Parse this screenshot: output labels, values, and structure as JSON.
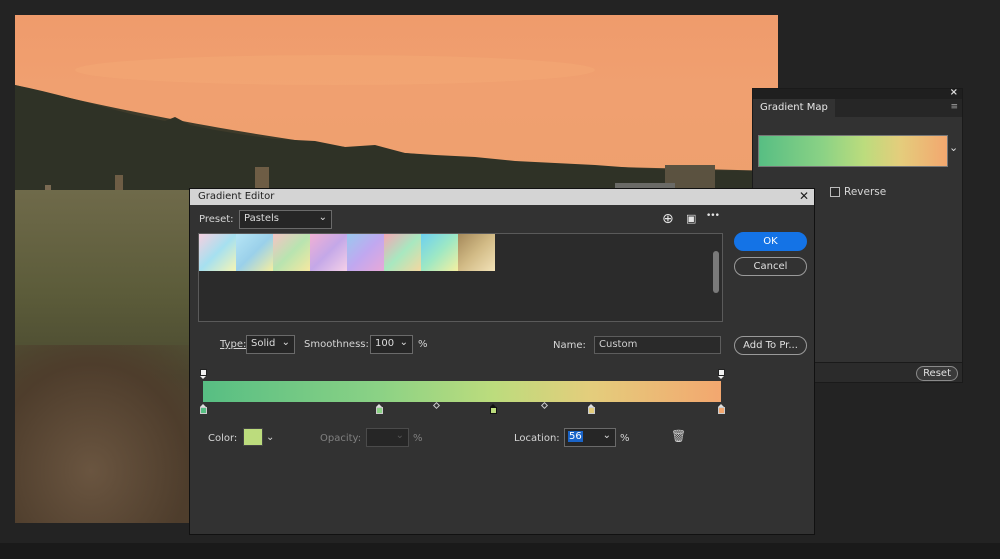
{
  "colors": {
    "accent": "#1473e6",
    "gradient_stops": [
      "#57be83",
      "#8bd285",
      "#c6df7c",
      "#e4cd7c",
      "#f3a76f"
    ],
    "selected_stop_color": "#bcdc7d"
  },
  "gradient_map_panel": {
    "tab_label": "Gradient Map",
    "close_glyph": "×",
    "menu_glyph": "≡",
    "dropdown_glyph": "⌄",
    "reverse_label": "Reverse",
    "reset_label": "Reset"
  },
  "gradient_editor": {
    "title": "Gradient Editor",
    "close_glyph": "✕",
    "preset_label": "Preset:",
    "preset_value": "Pastels",
    "icons": [
      "add-icon",
      "save-icon",
      "more-icon"
    ],
    "add_glyph": "⊕",
    "save_glyph": "▣",
    "more_glyph": "•••",
    "ok_label": "OK",
    "cancel_label": "Cancel",
    "add_to_preset_label": "Add To Pr...",
    "type_label": "Type:",
    "type_value": "Solid",
    "smoothness_label": "Smoothness:",
    "smoothness_value": "100",
    "smoothness_unit": "%",
    "name_label": "Name:",
    "name_value": "Custom",
    "color_label": "Color:",
    "opacity_label": "Opacity:",
    "opacity_unit": "%",
    "location_label": "Location:",
    "location_value": "56",
    "location_unit": "%",
    "delete_glyph": "🗑",
    "dropdown_glyph": "⌄",
    "presets": [
      {
        "name": "pastel-1",
        "colors": [
          "#f6d0e0",
          "#a6e0f0",
          "#f5f5b4"
        ]
      },
      {
        "name": "pastel-2",
        "colors": [
          "#b6e5f5",
          "#9ad0ea",
          "#f5eea0"
        ]
      },
      {
        "name": "pastel-3",
        "colors": [
          "#f4c4c4",
          "#b8e4b0",
          "#f6e8a0"
        ]
      },
      {
        "name": "pastel-4",
        "colors": [
          "#f1b0d4",
          "#c4a8e8",
          "#f5d0e8"
        ]
      },
      {
        "name": "pastel-5",
        "colors": [
          "#9ac8ee",
          "#c0a8f0",
          "#e8a8d8"
        ]
      },
      {
        "name": "pastel-6",
        "colors": [
          "#f3a8b4",
          "#a8e8c0",
          "#f5d8a0"
        ]
      },
      {
        "name": "pastel-7",
        "colors": [
          "#6cd0f0",
          "#9ee8c4",
          "#f5f0a0"
        ]
      },
      {
        "name": "pastel-8",
        "colors": [
          "#a5895a",
          "#d2bb86",
          "#f2e2b8"
        ]
      }
    ],
    "color_stops": [
      {
        "location": 0,
        "color": "#57be83"
      },
      {
        "location": 34,
        "color": "#8bd285"
      },
      {
        "location": 56,
        "color": "#bcdc7d",
        "selected": true
      },
      {
        "location": 75,
        "color": "#e4cd7c"
      },
      {
        "location": 100,
        "color": "#f3a76f"
      }
    ],
    "midpoints": [
      45,
      66
    ],
    "opacity_stops": [
      0,
      100
    ]
  }
}
